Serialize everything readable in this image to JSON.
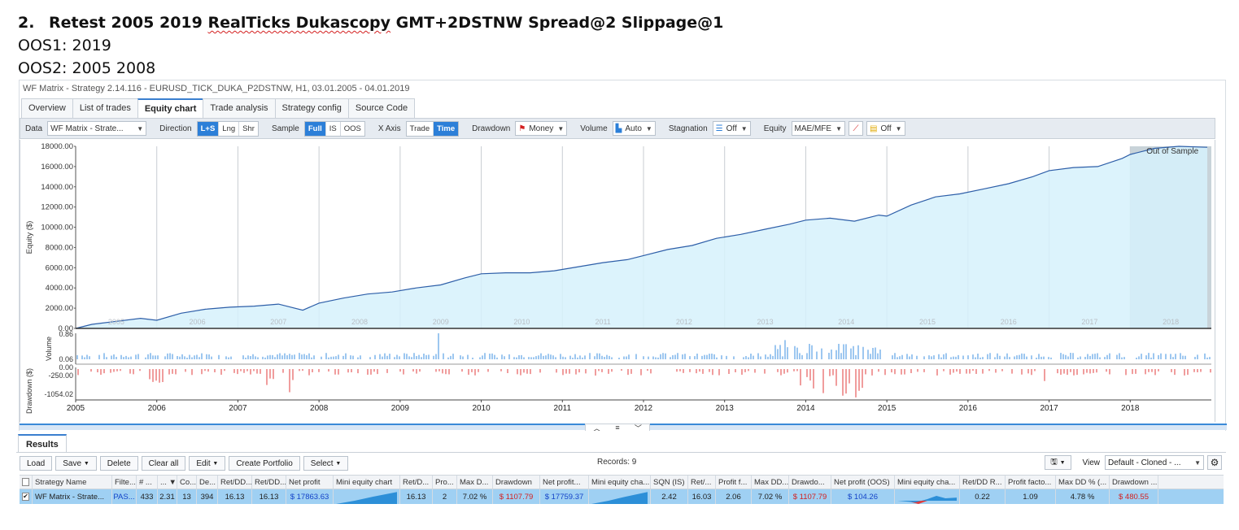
{
  "doc": {
    "heading_num": "2.",
    "heading_pre": "Retest 2005 2019 ",
    "heading_squig": "RealTicks Dukascopy",
    "heading_post": " GMT+2DSTNW Spread@2 Slippage@1",
    "oos1": "OOS1: 2019",
    "oos2": "OOS2: 2005 2008"
  },
  "app": {
    "title": "WF Matrix - Strategy 2.14.116 - EURUSD_TICK_DUKA_P2DSTNW, H1, 03.01.2005 - 04.01.2019",
    "tabs": [
      "Overview",
      "List of trades",
      "Equity chart",
      "Trade analysis",
      "Strategy config",
      "Source Code"
    ],
    "active_tab": 2
  },
  "toolbar": {
    "data_label": "Data",
    "data_value": "WF Matrix - Strate...",
    "direction_label": "Direction",
    "direction": [
      "L+S",
      "Lng",
      "Shr"
    ],
    "sample_label": "Sample",
    "sample": [
      "Full",
      "IS",
      "OOS"
    ],
    "xaxis_label": "X Axis",
    "xaxis": [
      "Trade",
      "Time"
    ],
    "drawdown_label": "Drawdown",
    "drawdown_value": "Money",
    "volume_label": "Volume",
    "volume_value": "Auto",
    "stagnation_label": "Stagnation",
    "stagnation_value": "Off",
    "equity_label": "Equity",
    "equity_value": "MAE/MFE",
    "equity_off": "Off"
  },
  "chart_data": {
    "type": "area",
    "ylabel": "Equity ($)",
    "y_ticks": [
      "0.00",
      "2000.00",
      "4000.00",
      "6000.00",
      "8000.00",
      "10000.00",
      "12000.00",
      "14000.00",
      "16000.00",
      "18000.00"
    ],
    "ylim": [
      0,
      18000
    ],
    "x_year_labels": [
      "2005",
      "2006",
      "2007",
      "2008",
      "2009",
      "2010",
      "2011",
      "2012",
      "2013",
      "2014",
      "2015",
      "2016",
      "2017",
      "2018"
    ],
    "oos_label": "Out of Sample",
    "series": [
      {
        "values_x_year": [
          2005.0,
          2005.2,
          2005.5,
          2005.8,
          2006.0,
          2006.3,
          2006.6,
          2006.9,
          2007.2,
          2007.5,
          2007.8,
          2008.0,
          2008.3,
          2008.6,
          2008.9,
          2009.2,
          2009.5,
          2009.8,
          2010.0,
          2010.3,
          2010.6,
          2010.9,
          2011.2,
          2011.5,
          2011.8,
          2012.0,
          2012.3,
          2012.6,
          2012.9,
          2013.2,
          2013.5,
          2013.8,
          2014.0,
          2014.3,
          2014.6,
          2014.9,
          2015.0,
          2015.3,
          2015.6,
          2015.9,
          2016.2,
          2016.5,
          2016.8,
          2017.0,
          2017.3,
          2017.6,
          2017.9,
          2018.0,
          2018.3,
          2018.6,
          2018.95
        ],
        "values_y": [
          0,
          400,
          700,
          1000,
          800,
          1500,
          1900,
          2100,
          2200,
          2400,
          1800,
          2500,
          3000,
          3400,
          3600,
          4000,
          4300,
          5000,
          5400,
          5500,
          5500,
          5700,
          6100,
          6500,
          6800,
          7200,
          7800,
          8200,
          8900,
          9300,
          9800,
          10300,
          10700,
          10900,
          10600,
          11200,
          11100,
          12200,
          13000,
          13300,
          13800,
          14300,
          15000,
          15600,
          15900,
          16000,
          16800,
          17200,
          17800,
          18000,
          17900
        ]
      }
    ],
    "volume": {
      "ylabel": "Volume",
      "ticks": [
        "0.86",
        "0.06"
      ]
    },
    "drawdown": {
      "ylabel": "Drawdown ($)",
      "ticks": [
        "0.00",
        "-250.00",
        "-1054.02"
      ]
    },
    "x_bottom_labels": [
      "2005",
      "2006",
      "2007",
      "2008",
      "2009",
      "2010",
      "2011",
      "2012",
      "2013",
      "2014",
      "2015",
      "2016",
      "2017",
      "2018"
    ]
  },
  "results": {
    "tab": "Results",
    "buttons": [
      "Load",
      "Save",
      "Delete",
      "Clear all",
      "Edit",
      "Create Portfolio",
      "Select"
    ],
    "records": "Records: 9",
    "view_label": "View",
    "view_value": "Default - Cloned - ...",
    "columns": [
      "Strategy Name",
      "Filte...",
      "# ...",
      "... ▼¹",
      "Co...",
      "De...",
      "Ret/DD...",
      "Ret/DD...",
      "Net profit",
      "Mini equity chart",
      "Ret/D...",
      "Pro...",
      "Max D...",
      "Drawdown",
      "Net profit...",
      "Mini equity cha...",
      "SQN (IS)",
      "Ret/...",
      "Profit f...",
      "Max DD...",
      "Drawdo...",
      "Net profit (OOS)",
      "Mini equity cha...",
      "Ret/DD R...",
      "Profit facto...",
      "Max DD % (...",
      "Drawdown ..."
    ],
    "row": [
      "WF Matrix - Strate...",
      "PAS...",
      "433",
      "2.31",
      "13",
      "394",
      "16.13",
      "16.13",
      "$ 17863.63",
      "",
      "16.13",
      "2",
      "7.02 %",
      "$ 1107.79",
      "$ 17759.37",
      "",
      "2.42",
      "16.03",
      "2.06",
      "7.02 %",
      "$ 1107.79",
      "$ 104.26",
      "",
      "0.22",
      "1.09",
      "4.78 %",
      "$ 480.55"
    ]
  },
  "colors": {
    "accent": "#2c7fd8",
    "equity_fill": "#d6f1fb",
    "equity_line": "#2d5ea8",
    "drawdown": "#e23b3b",
    "volume": "#3b8fe0",
    "oos_bg": "#c8d3d9"
  }
}
